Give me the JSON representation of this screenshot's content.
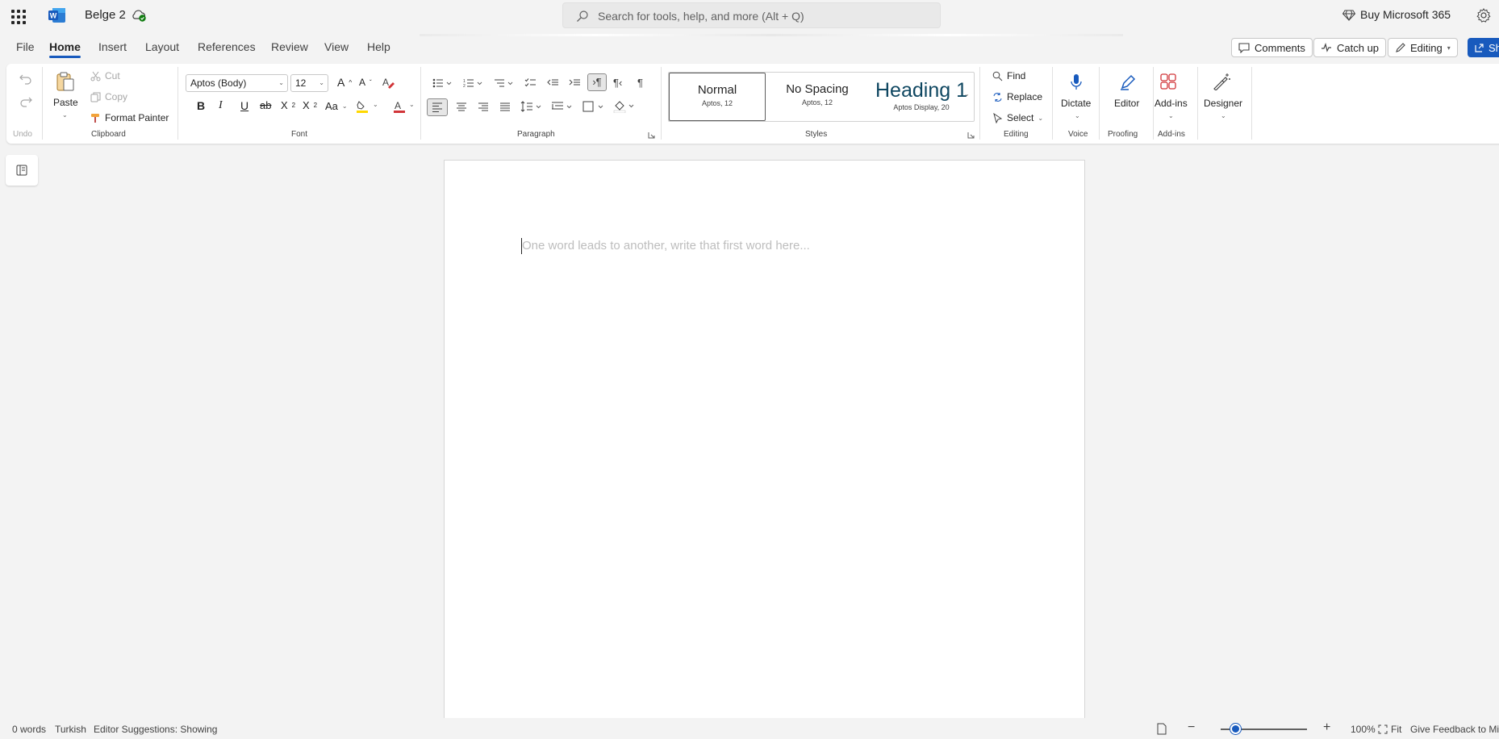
{
  "app": {
    "title": "Belge 2",
    "search_placeholder": "Search for tools, help, and more (Alt + Q)",
    "buy_label": "Buy Microsoft 365",
    "brand_color": "#185abd"
  },
  "tabs": [
    "File",
    "Home",
    "Insert",
    "Layout",
    "References",
    "Review",
    "View",
    "Help"
  ],
  "header_buttons": {
    "comments": "Comments",
    "catch_up": "Catch up",
    "editing": "Editing",
    "share": "Sh"
  },
  "ribbon": {
    "undo_group": "Undo",
    "clipboard": {
      "paste": "Paste",
      "cut": "Cut",
      "copy": "Copy",
      "format_painter": "Format Painter",
      "label": "Clipboard"
    },
    "font": {
      "font_name": "Aptos (Body)",
      "font_size": "12",
      "label": "Font"
    },
    "paragraph": {
      "label": "Paragraph"
    },
    "styles": {
      "label": "Styles",
      "items": [
        {
          "name": "Normal",
          "sub": "Aptos, 12"
        },
        {
          "name": "No Spacing",
          "sub": "Aptos, 12"
        },
        {
          "name": "Heading 1",
          "sub": "Aptos Display, 20"
        }
      ]
    },
    "editing": {
      "find": "Find",
      "replace": "Replace",
      "select": "Select",
      "label": "Editing"
    },
    "voice": {
      "dictate": "Dictate",
      "label": "Voice"
    },
    "proofing": {
      "editor": "Editor",
      "label": "Proofing"
    },
    "addins": {
      "addins": "Add-ins",
      "label": "Add-ins"
    },
    "designer": {
      "designer": "Designer"
    }
  },
  "document": {
    "placeholder": "One word leads to another, write that first word here..."
  },
  "status": {
    "words": "0 words",
    "language": "Turkish",
    "editor_suggestions": "Editor Suggestions: Showing",
    "zoom": "100%",
    "zoom_percent": 100,
    "fit": "Fit",
    "feedback": "Give Feedback to Mi"
  }
}
